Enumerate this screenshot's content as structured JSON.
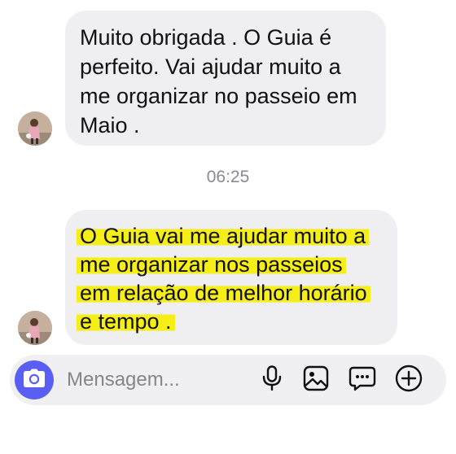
{
  "messages": [
    {
      "lines": [
        "Muito obrigada . O Guia é",
        "perfeito. Vai ajudar muito a",
        "me organizar no passeio em",
        "Maio ."
      ],
      "highlighted": false
    },
    {
      "lines": [
        "O Guia vai me ajudar muito a",
        "me organizar nos passeios",
        "em relação de melhor horário",
        "e tempo ."
      ],
      "highlighted": true,
      "highlight_color": "#f6ee17"
    }
  ],
  "timestamp": "06:25",
  "composer": {
    "placeholder": "Mensagem...",
    "camera_icon": "camera-icon",
    "mic_icon": "microphone-icon",
    "gallery_icon": "image-icon",
    "sticker_icon": "chat-bubble-icon",
    "add_icon": "plus-circle-icon"
  },
  "colors": {
    "bubble": "#efeff1",
    "camera_button": "#5a5ff3",
    "timestamp_text": "#8a8a8e"
  }
}
